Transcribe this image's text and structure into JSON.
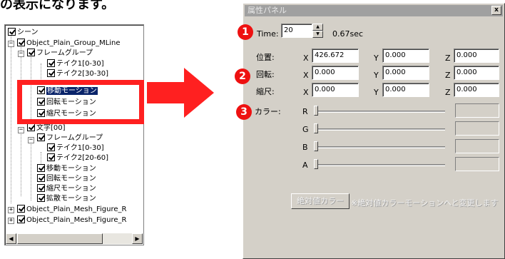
{
  "headline": "の表示になります。",
  "tree": {
    "items": [
      {
        "label": "シーン"
      },
      {
        "label": "Object_Plain_Group_MLine"
      },
      {
        "label": "フレームグループ"
      },
      {
        "label": "テイク1[0-30]"
      },
      {
        "label": "テイク2[30-30]"
      },
      {
        "label": "移動モーション"
      },
      {
        "label": "回転モーション"
      },
      {
        "label": "縮尺モーション"
      },
      {
        "label": "文字[00]"
      },
      {
        "label": "フレームグループ"
      },
      {
        "label": "テイク1[0-30]"
      },
      {
        "label": "テイク2[20-60]"
      },
      {
        "label": "移動モーション"
      },
      {
        "label": "回転モーション"
      },
      {
        "label": "縮尺モーション"
      },
      {
        "label": "拡散モーション"
      },
      {
        "label": "Object_Plain_Mesh_Figure_R"
      },
      {
        "label": "Object_Plain_Mesh_Figure_R"
      }
    ]
  },
  "panel": {
    "title": "属性パネル",
    "close_glyph": "x",
    "time_label": "Time:",
    "time_value": "20",
    "time_sec": "0.67sec",
    "rows": [
      {
        "label": "位置:",
        "x": "426.672",
        "y": "0.000",
        "z": "0.000"
      },
      {
        "label": "回転:",
        "x": "0.000",
        "y": "0.000",
        "z": "0.000"
      },
      {
        "label": "縮尺:",
        "x": "0.000",
        "y": "0.000",
        "z": "0.000"
      }
    ],
    "axis": {
      "x": "X",
      "y": "Y",
      "z": "Z"
    },
    "color_label": "カラー:",
    "channels": [
      "R",
      "G",
      "B",
      "A"
    ],
    "abs_color_button": "絶対値カラー",
    "note": "※絶対値カラーモーションへと変更します"
  },
  "badges": [
    "1",
    "2",
    "3"
  ],
  "colors": {
    "highlight": "#ff2020",
    "badge": "#ee1111",
    "selection": "#0a246a",
    "panel_bg": "#d4d0c8"
  }
}
